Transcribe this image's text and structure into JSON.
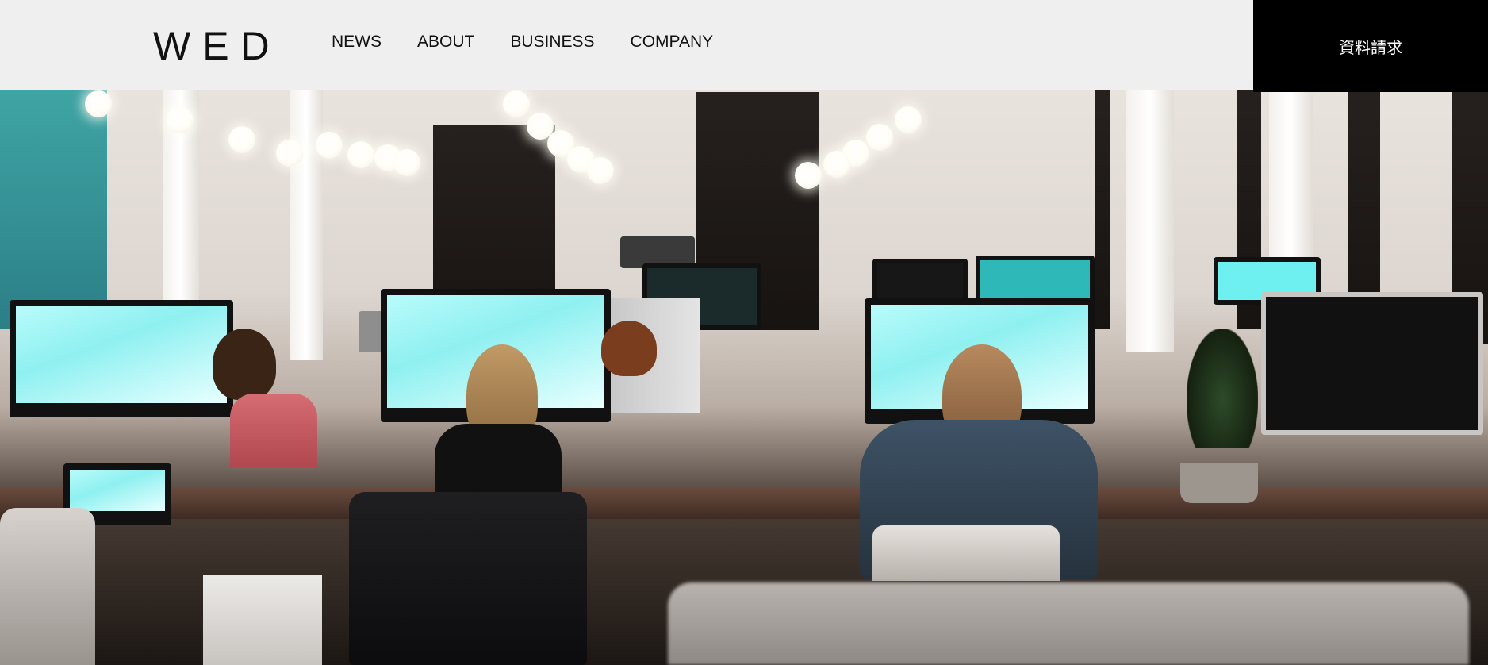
{
  "header": {
    "logo": "WED",
    "nav": [
      "NEWS",
      "ABOUT",
      "BUSINESS",
      "COMPANY"
    ],
    "cta_label": "資料請求"
  },
  "hero": {
    "image": "office-interior-photo"
  },
  "colors": {
    "header_bg": "#efefef",
    "cta_bg": "#000000",
    "cta_text": "#ffffff",
    "nav_text": "#111111"
  }
}
